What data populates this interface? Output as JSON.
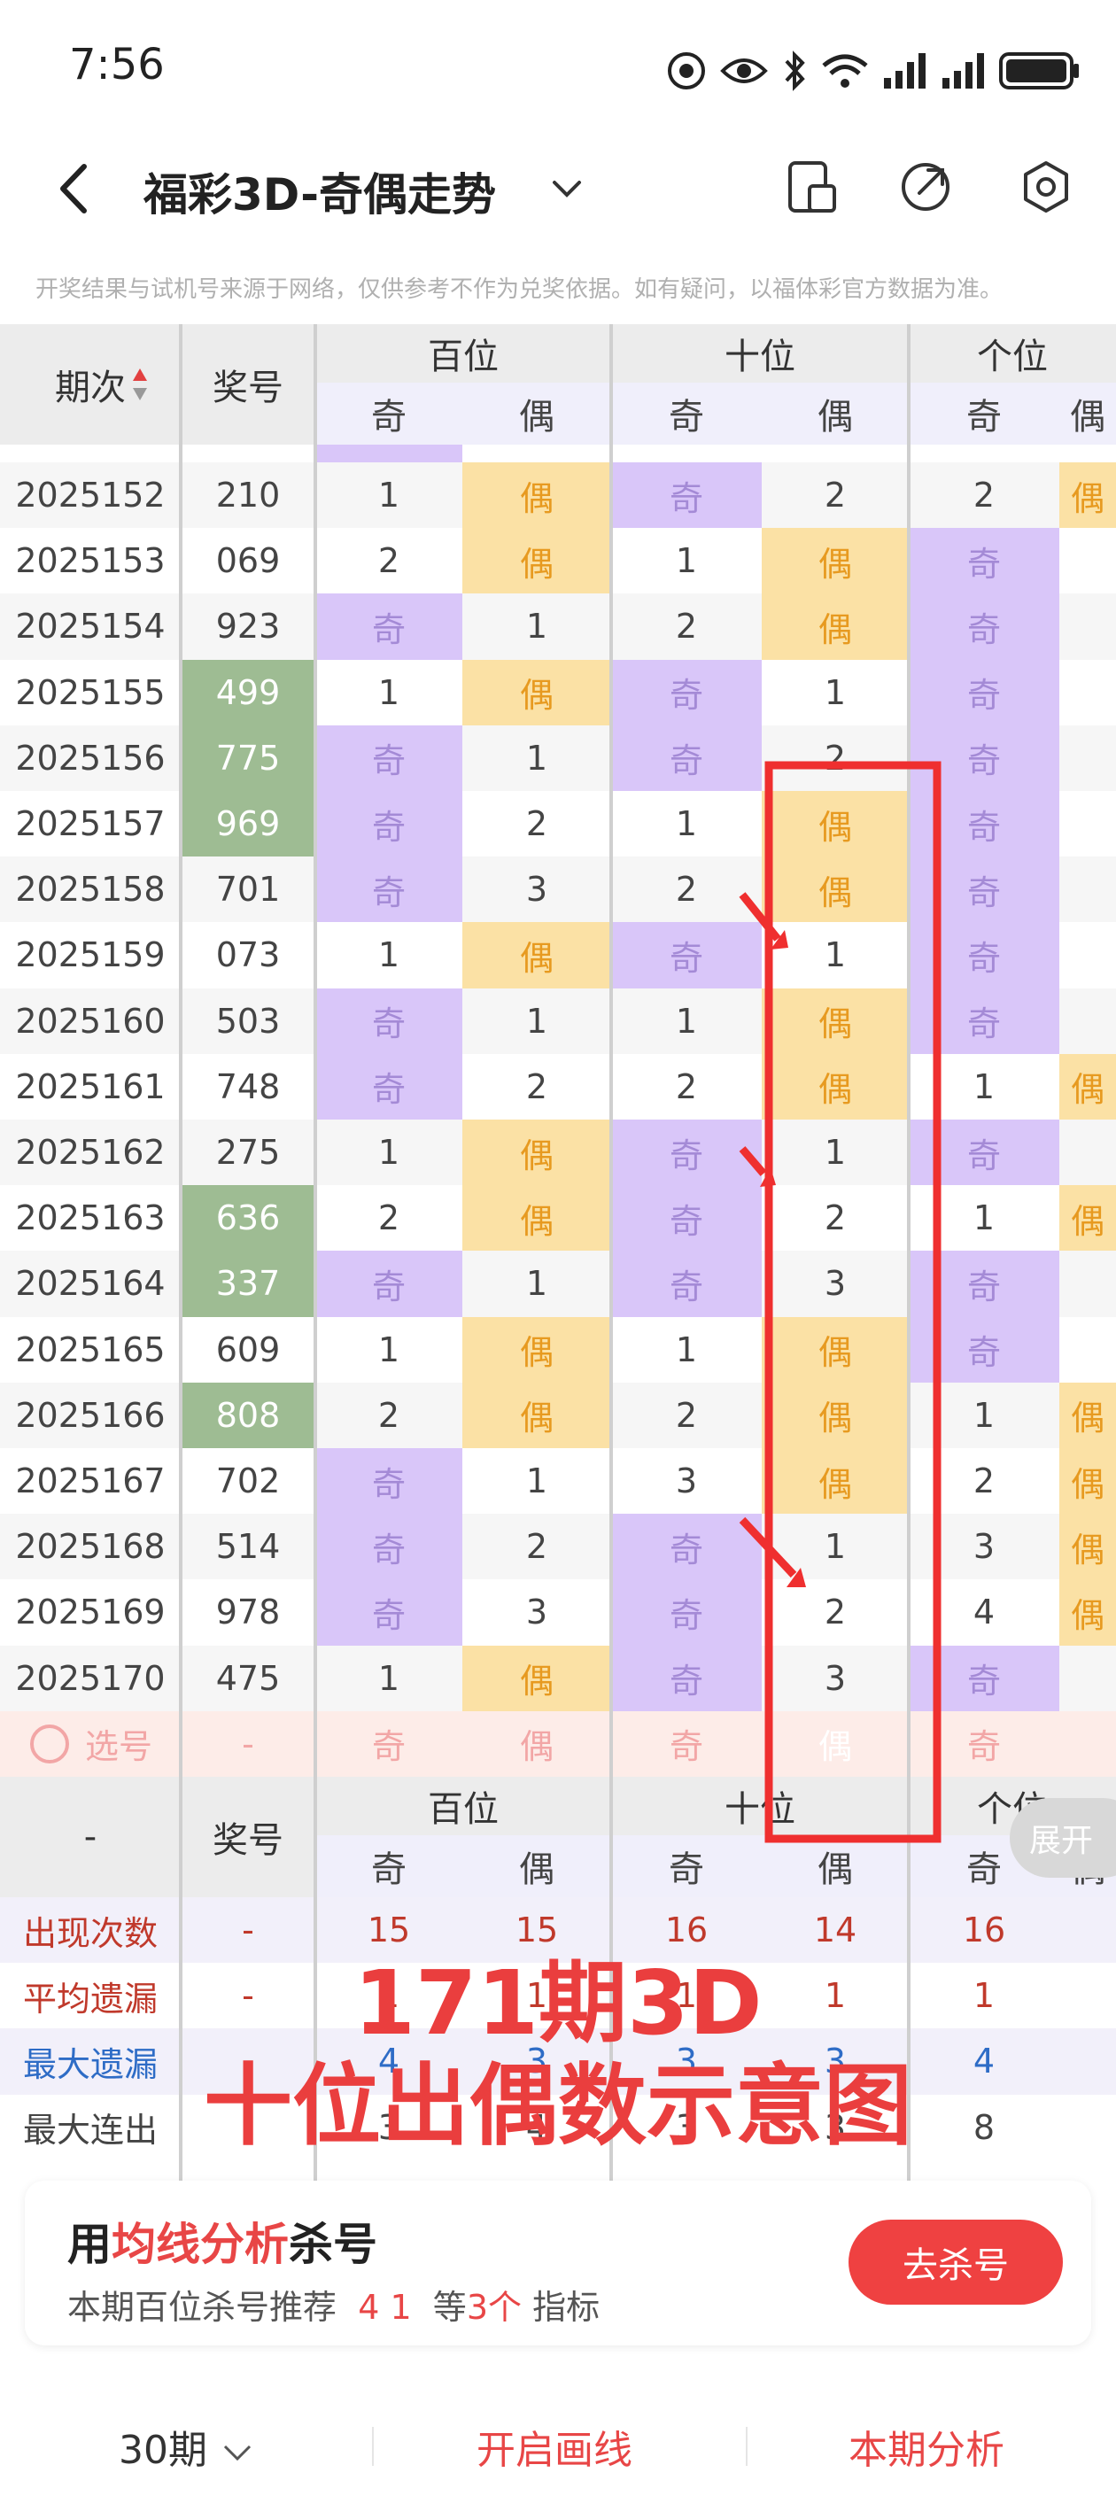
{
  "status_bar": {
    "time": "7:56",
    "signal_label": "6"
  },
  "header": {
    "title": "福彩3D-奇偶走势"
  },
  "notice": "开奖结果与试机号来源于网络，仅供参考不作为兑奖依据。如有疑问，以福体彩官方数据为准。",
  "table": {
    "col_period": "期次",
    "col_number": "奖号",
    "groups": [
      "百位",
      "十位",
      "个位"
    ],
    "sub": [
      "奇",
      "偶"
    ],
    "rows": [
      {
        "period": "2025152",
        "num": "210",
        "cells": [
          "1",
          "偶",
          "奇",
          "2",
          "2",
          "偶"
        ],
        "hl": false
      },
      {
        "period": "2025153",
        "num": "069",
        "cells": [
          "2",
          "偶",
          "1",
          "偶",
          "奇",
          ""
        ],
        "hl": false
      },
      {
        "period": "2025154",
        "num": "923",
        "cells": [
          "奇",
          "1",
          "2",
          "偶",
          "奇",
          ""
        ],
        "hl": false
      },
      {
        "period": "2025155",
        "num": "499",
        "cells": [
          "1",
          "偶",
          "奇",
          "1",
          "奇",
          ""
        ],
        "hl": true
      },
      {
        "period": "2025156",
        "num": "775",
        "cells": [
          "奇",
          "1",
          "奇",
          "2",
          "奇",
          ""
        ],
        "hl": true
      },
      {
        "period": "2025157",
        "num": "969",
        "cells": [
          "奇",
          "2",
          "1",
          "偶",
          "奇",
          ""
        ],
        "hl": true
      },
      {
        "period": "2025158",
        "num": "701",
        "cells": [
          "奇",
          "3",
          "2",
          "偶",
          "奇",
          ""
        ],
        "hl": false
      },
      {
        "period": "2025159",
        "num": "073",
        "cells": [
          "1",
          "偶",
          "奇",
          "1",
          "奇",
          ""
        ],
        "hl": false
      },
      {
        "period": "2025160",
        "num": "503",
        "cells": [
          "奇",
          "1",
          "1",
          "偶",
          "奇",
          ""
        ],
        "hl": false
      },
      {
        "period": "2025161",
        "num": "748",
        "cells": [
          "奇",
          "2",
          "2",
          "偶",
          "1",
          "偶"
        ],
        "hl": false
      },
      {
        "period": "2025162",
        "num": "275",
        "cells": [
          "1",
          "偶",
          "奇",
          "1",
          "奇",
          ""
        ],
        "hl": false
      },
      {
        "period": "2025163",
        "num": "636",
        "cells": [
          "2",
          "偶",
          "奇",
          "2",
          "1",
          "偶"
        ],
        "hl": true
      },
      {
        "period": "2025164",
        "num": "337",
        "cells": [
          "奇",
          "1",
          "奇",
          "3",
          "奇",
          ""
        ],
        "hl": true
      },
      {
        "period": "2025165",
        "num": "609",
        "cells": [
          "1",
          "偶",
          "1",
          "偶",
          "奇",
          ""
        ],
        "hl": false
      },
      {
        "period": "2025166",
        "num": "808",
        "cells": [
          "2",
          "偶",
          "2",
          "偶",
          "1",
          "偶"
        ],
        "hl": true
      },
      {
        "period": "2025167",
        "num": "702",
        "cells": [
          "奇",
          "1",
          "3",
          "偶",
          "2",
          "偶"
        ],
        "hl": false
      },
      {
        "period": "2025168",
        "num": "514",
        "cells": [
          "奇",
          "2",
          "奇",
          "1",
          "3",
          "偶"
        ],
        "hl": false
      },
      {
        "period": "2025169",
        "num": "978",
        "cells": [
          "奇",
          "3",
          "奇",
          "2",
          "4",
          "偶"
        ],
        "hl": false
      },
      {
        "period": "2025170",
        "num": "475",
        "cells": [
          "1",
          "偶",
          "奇",
          "3",
          "奇",
          ""
        ],
        "hl": false
      }
    ],
    "select_row": {
      "label": "选号",
      "num": "-",
      "cells": [
        "奇",
        "偶",
        "奇",
        "偶",
        "奇",
        ""
      ]
    },
    "stats": [
      {
        "label": "出现次数",
        "num": "-",
        "cells": [
          "15",
          "15",
          "16",
          "14",
          "16",
          ""
        ],
        "color": "#c0392b"
      },
      {
        "label": "平均遗漏",
        "num": "-",
        "cells": [
          "1",
          "1",
          "1",
          "1",
          "1",
          ""
        ],
        "color": "#c0392b"
      },
      {
        "label": "最大遗漏",
        "num": "-",
        "cells": [
          "4",
          "3",
          "3",
          "3",
          "4",
          ""
        ],
        "color": "#2e6cc6"
      },
      {
        "label": "最大连出",
        "num": "-",
        "cells": [
          "3",
          "4",
          "3",
          "3",
          "8",
          ""
        ],
        "color": "#444"
      }
    ],
    "footer_dash": "-",
    "footer_num_label": "奖号"
  },
  "annotation": {
    "line1": "171期3D",
    "line2": "十位出偶数示意图"
  },
  "expand_label": "展开",
  "promo": {
    "title_pre": "用",
    "title_hl": "均线分析",
    "title_post": "杀号",
    "sub_pre": "本期百位杀号推荐",
    "sub_nums": "4 1",
    "sub_mid": "等",
    "sub_count": "3个",
    "sub_post": "指标",
    "button": "去杀号"
  },
  "bottom": {
    "periods": "30期",
    "draw": "开启画线",
    "analysis": "本期分析"
  },
  "colors": {
    "odd": "#d9c6f9",
    "even": "#fbe1a5",
    "accent": "#ea3e3e",
    "winner": "#9ebc93"
  }
}
